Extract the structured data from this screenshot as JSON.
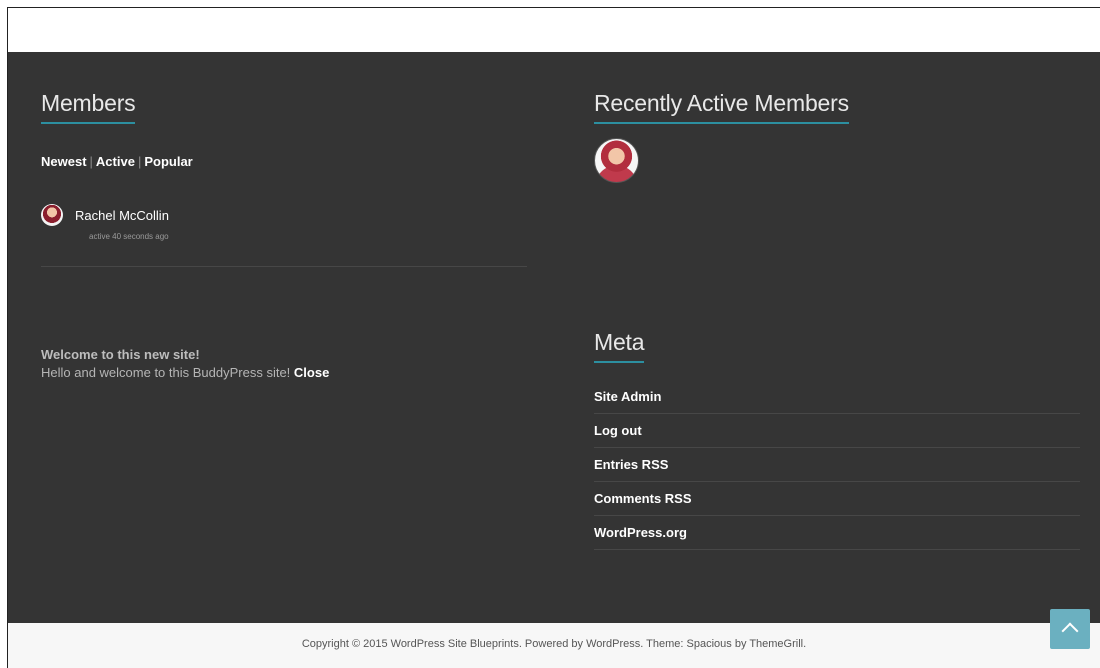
{
  "members_widget": {
    "title": "Members",
    "filters": [
      "Newest",
      "Active",
      "Popular"
    ],
    "member": {
      "name": "Rachel McCollin",
      "activity": "active 40 seconds ago"
    }
  },
  "welcome_notice": {
    "title": "Welcome to this new site!",
    "message": "Hello and welcome to this BuddyPress site!",
    "close_label": "Close"
  },
  "recent_widget": {
    "title": "Recently Active Members"
  },
  "meta_widget": {
    "title": "Meta",
    "links": [
      "Site Admin",
      "Log out",
      "Entries RSS",
      "Comments RSS",
      "WordPress.org"
    ]
  },
  "footer": {
    "copyright": "Copyright © 2015 WordPress Site Blueprints. Powered by WordPress. Theme: Spacious by ThemeGrill."
  },
  "icons": {
    "scroll_top": "chevron-up-icon"
  },
  "colors": {
    "widget_bg": "#343434",
    "accent_underline": "#2c8fa0",
    "scroll_top_bg": "#6bb0c0",
    "footer_bg": "#f7f7f7"
  }
}
